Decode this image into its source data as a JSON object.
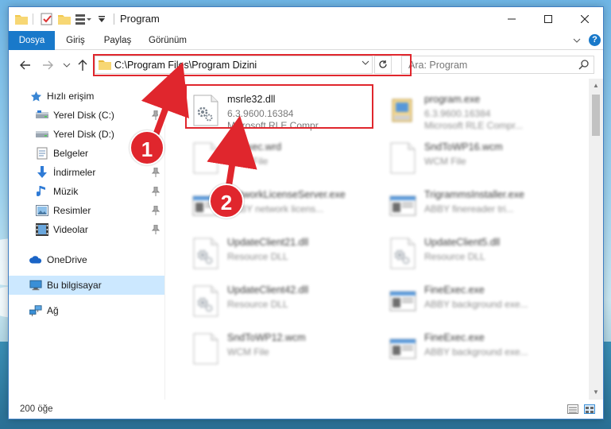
{
  "window": {
    "title": "Program"
  },
  "ribbon": {
    "tabs": [
      "Dosya",
      "Giriş",
      "Paylaş",
      "Görünüm"
    ]
  },
  "address": {
    "path": "C:\\Program Files\\Program Dizini"
  },
  "search": {
    "placeholder": "Ara: Program"
  },
  "sidebar": {
    "items": [
      {
        "label": "Hızlı erişim",
        "icon": "star-icon"
      },
      {
        "label": "Yerel Disk (C:)",
        "icon": "drive-icon"
      },
      {
        "label": "Yerel Disk (D:)",
        "icon": "drive-icon"
      },
      {
        "label": "Belgeler",
        "icon": "documents-icon"
      },
      {
        "label": "İndirmeler",
        "icon": "download-icon"
      },
      {
        "label": "Müzik",
        "icon": "music-icon"
      },
      {
        "label": "Resimler",
        "icon": "pictures-icon"
      },
      {
        "label": "Videolar",
        "icon": "video-icon"
      },
      {
        "label": "OneDrive",
        "icon": "cloud-icon"
      },
      {
        "label": "Bu bilgisayar",
        "icon": "computer-icon"
      },
      {
        "label": "Ağ",
        "icon": "network-icon"
      }
    ]
  },
  "files": [
    {
      "name": "msrle32.dll",
      "line2": "6.3.9600.16384",
      "line3": "Microsoft RLE Compr...",
      "icon": "dll-gear-icon",
      "blurred": false
    },
    {
      "name": "program.exe",
      "line2": "6.3.9600.16384",
      "line3": "Microsoft RLE Compr...",
      "icon": "exe-icon",
      "blurred": true
    },
    {
      "name": "BBExec.wrd",
      "line2": "WRD File",
      "line3": "",
      "icon": "blank-file-icon",
      "blurred": true
    },
    {
      "name": "SndToWP16.wcm",
      "line2": "WCM File",
      "line3": "",
      "icon": "blank-file-icon",
      "blurred": true
    },
    {
      "name": "NetworkLicenseServer.exe",
      "line2": "ABBY network licens...",
      "line3": "",
      "icon": "window-exe-icon",
      "blurred": true
    },
    {
      "name": "TrigrammsInstaller.exe",
      "line2": "ABBY finereader tri...",
      "line3": "",
      "icon": "window-exe-icon",
      "blurred": true
    },
    {
      "name": "UpdateClient21.dll",
      "line2": "Resource DLL",
      "line3": "",
      "icon": "dll-gear-icon",
      "blurred": true
    },
    {
      "name": "UpdateClient5.dll",
      "line2": "Resource DLL",
      "line3": "",
      "icon": "dll-gear-icon",
      "blurred": true
    },
    {
      "name": "UpdateClient42.dll",
      "line2": "Resource DLL",
      "line3": "",
      "icon": "dll-gear-icon",
      "blurred": true
    },
    {
      "name": "FineExec.exe",
      "line2": "ABBY background exe...",
      "line3": "",
      "icon": "window-exe-icon",
      "blurred": true
    },
    {
      "name": "SndToWP12.wcm",
      "line2": "WCM File",
      "line3": "",
      "icon": "blank-file-icon",
      "blurred": true
    },
    {
      "name": "FineExec.exe",
      "line2": "ABBY background exe...",
      "line3": "",
      "icon": "window-exe-icon",
      "blurred": true
    }
  ],
  "status": {
    "count": "200 öğe"
  },
  "badges": [
    "1",
    "2"
  ],
  "colors": {
    "accent": "#1979ca",
    "annotation": "#e0262d",
    "selection": "#cce8ff"
  }
}
